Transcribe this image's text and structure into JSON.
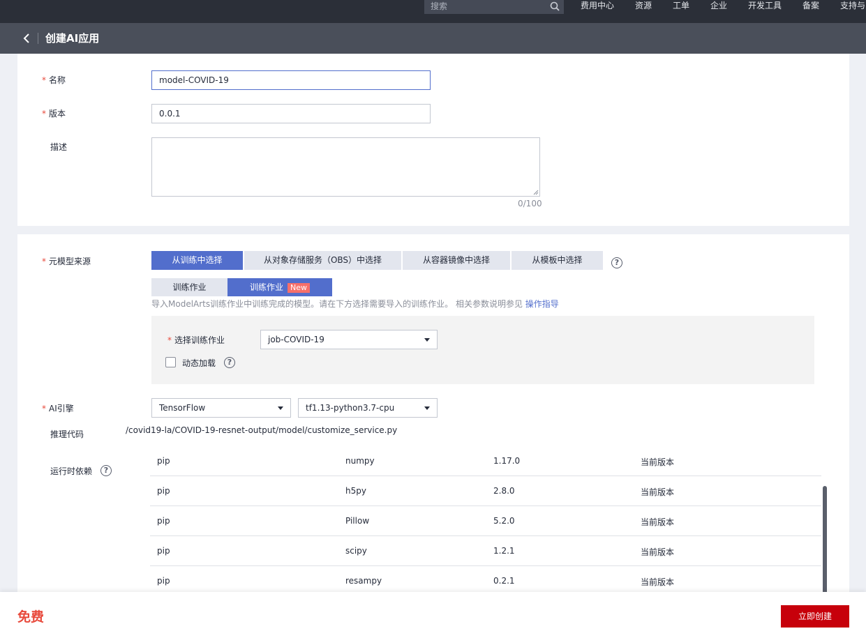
{
  "topnav": {
    "search_placeholder": "搜索",
    "items": [
      "费用中心",
      "资源",
      "工单",
      "企业",
      "开发工具",
      "备案",
      "支持与"
    ]
  },
  "titlebar": {
    "title": "创建AI应用"
  },
  "form": {
    "name": {
      "label": "名称",
      "value": "model-COVID-19"
    },
    "version": {
      "label": "版本",
      "value": "0.0.1"
    },
    "description": {
      "label": "描述",
      "value": "",
      "counter": "0/100"
    },
    "source": {
      "label": "元模型来源",
      "options": [
        "从训练中选择",
        "从对象存储服务（OBS）中选择",
        "从容器镜像中选择",
        "从模板中选择"
      ],
      "selected_index": 0
    },
    "train_tabs": [
      "训练作业",
      "训练作业"
    ],
    "new_badge": "New",
    "hint": "导入ModelArts训练作业中训练完成的模型。请在下方选择需要导入的训练作业。 相关参数说明参见",
    "hint_link": "操作指导",
    "job": {
      "label": "选择训练作业",
      "value": "job-COVID-19"
    },
    "dynamic_load": {
      "label": "动态加载",
      "checked": false
    },
    "engine": {
      "label": "AI引擎",
      "framework": "TensorFlow",
      "runtime": "tf1.13-python3.7-cpu"
    },
    "inference_code": {
      "label": "推理代码",
      "path": "/covid19-la/COVID-19-resnet-output/model/customize_service.py"
    },
    "runtime_deps": {
      "label": "运行时依赖",
      "rows": [
        {
          "installer": "pip",
          "package": "numpy",
          "version": "1.17.0",
          "restraint": "当前版本"
        },
        {
          "installer": "pip",
          "package": "h5py",
          "version": "2.8.0",
          "restraint": "当前版本"
        },
        {
          "installer": "pip",
          "package": "Pillow",
          "version": "5.2.0",
          "restraint": "当前版本"
        },
        {
          "installer": "pip",
          "package": "scipy",
          "version": "1.2.1",
          "restraint": "当前版本"
        },
        {
          "installer": "pip",
          "package": "resampy",
          "version": "0.2.1",
          "restraint": "当前版本"
        }
      ]
    }
  },
  "footer": {
    "price": "免费",
    "create_label": "立即创建"
  },
  "colors": {
    "primary": "#526ecc",
    "danger": "#c7000b",
    "required": "#e84a3c"
  }
}
